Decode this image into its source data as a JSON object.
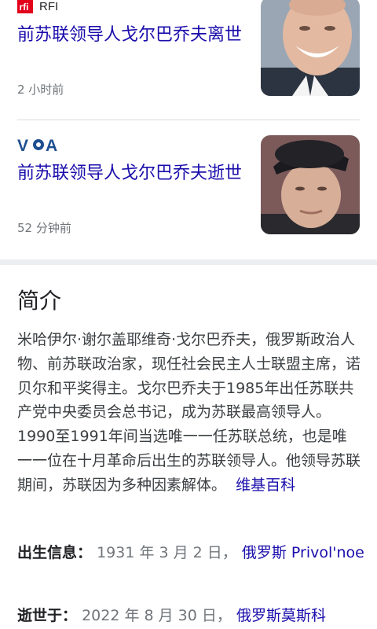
{
  "news": [
    {
      "source": "RFI",
      "source_logo": "rfi-logo",
      "title": "前苏联领导人戈尔巴乔夫离世",
      "time": "2 小时前"
    },
    {
      "source_logo": "voa-logo",
      "source_logo_text": "V•A",
      "title": "前苏联领导人戈尔巴乔夫逝世",
      "time": "52 分钟前"
    }
  ],
  "about": {
    "heading": "简介",
    "description": "米哈伊尔·谢尔盖耶维奇·戈尔巴乔夫，俄罗斯政治人物、前苏联政治家，现任社会民主人士联盟主席，诺贝尔和平奖得主。戈尔巴乔夫于1985年出任苏联共产党中央委员会总书记，成为苏联最高领导人。1990至1991年间当选唯一一任苏联总统，也是唯一一位在十月革命后出生的苏联领导人。他领导苏联期间，苏联因为多种因素解体。",
    "source_link": "维基百科",
    "facts": [
      {
        "label": "出生信息：",
        "value": "1931 年 3 月 2 日，",
        "link": "俄罗斯 Privol'noe"
      },
      {
        "label": "逝世于：",
        "value": "2022 年 8 月 30 日，",
        "link": "俄罗斯莫斯科"
      }
    ]
  },
  "colors": {
    "link": "#1a0dab",
    "rfi_red": "#e2001a",
    "voa_blue": "#1d4f91"
  }
}
